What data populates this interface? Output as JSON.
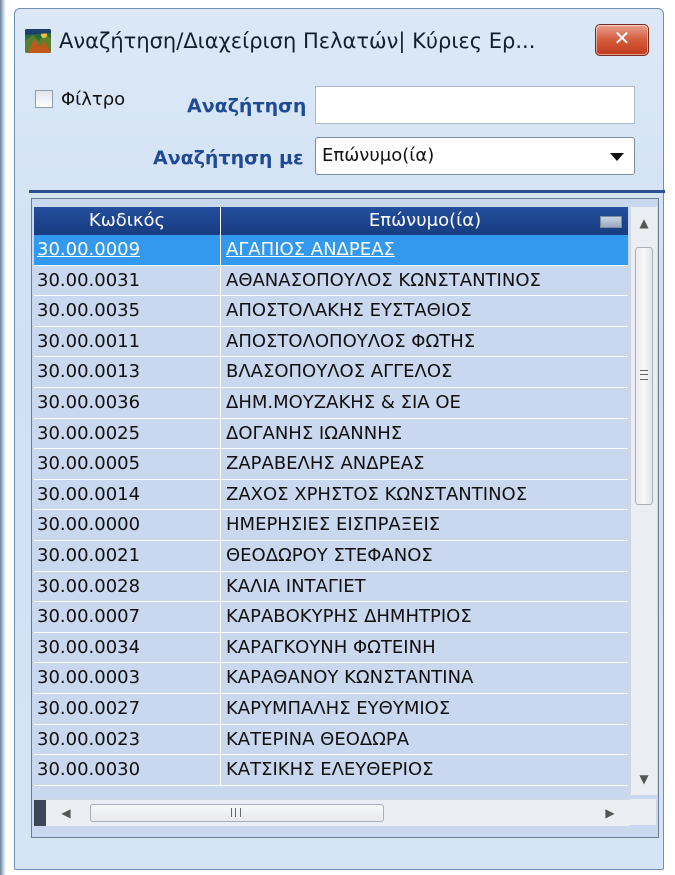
{
  "window": {
    "title": "Αναζήτηση/Διαχείριση Πελατών| Κύριες Ερ...",
    "close_label": "✕"
  },
  "filter": {
    "checkbox_label": "Φίλτρο",
    "checked": false
  },
  "search": {
    "label": "Αναζήτηση",
    "value": "",
    "placeholder": ""
  },
  "search_by": {
    "label": "Αναζήτηση με",
    "selected": "Επώνυμο(ία)"
  },
  "grid": {
    "columns": [
      "Κωδικός",
      "Επώνυμο(ία)"
    ],
    "rows": [
      {
        "code": "30.00.0009",
        "name": "ΑΓΑΠΙΟΣ ΑΝΔΡΕΑΣ",
        "selected": true
      },
      {
        "code": "30.00.0031",
        "name": "ΑΘΑΝΑΣΟΠΟΥΛΟΣ ΚΩΝΣΤΑΝΤΙΝΟΣ"
      },
      {
        "code": "30.00.0035",
        "name": "ΑΠΟΣΤΟΛΑΚΗΣ ΕΥΣΤΑΘΙΟΣ"
      },
      {
        "code": "30.00.0011",
        "name": "ΑΠΟΣΤΟΛΟΠΟΥΛΟΣ ΦΩΤΗΣ"
      },
      {
        "code": "30.00.0013",
        "name": "ΒΛΑΣΟΠΟΥΛΟΣ ΑΓΓΕΛΟΣ"
      },
      {
        "code": "30.00.0036",
        "name": "ΔΗΜ.ΜΟΥΖΑΚΗΣ & ΣΙΑ ΟΕ"
      },
      {
        "code": "30.00.0025",
        "name": "ΔΟΓΑΝΗΣ ΙΩΑΝΝΗΣ"
      },
      {
        "code": "30.00.0005",
        "name": "ΖΑΡΑΒΕΛΗΣ ΑΝΔΡΕΑΣ"
      },
      {
        "code": "30.00.0014",
        "name": "ΖΑΧΟΣ ΧΡΗΣΤΟΣ ΚΩΝΣΤΑΝΤΙΝΟΣ"
      },
      {
        "code": "30.00.0000",
        "name": "ΗΜΕΡΗΣΙΕΣ ΕΙΣΠΡΑΞΕΙΣ"
      },
      {
        "code": "30.00.0021",
        "name": "ΘΕΟΔΩΡΟΥ ΣΤΕΦΑΝΟΣ"
      },
      {
        "code": "30.00.0028",
        "name": "ΚΑΛΙΑ ΙΝΤΑΓΙΕΤ"
      },
      {
        "code": "30.00.0007",
        "name": "ΚΑΡΑΒΟΚΥΡΗΣ ΔΗΜΗΤΡΙΟΣ"
      },
      {
        "code": "30.00.0034",
        "name": "ΚΑΡΑΓΚΟΥΝΗ ΦΩΤΕΙΝΗ"
      },
      {
        "code": "30.00.0003",
        "name": "ΚΑΡΑΘΑΝΟΥ ΚΩΝΣΤΑΝΤΙΝΑ"
      },
      {
        "code": "30.00.0027",
        "name": "ΚΑΡΥΜΠΑΛΗΣ ΕΥΘΥΜΙΟΣ"
      },
      {
        "code": "30.00.0023",
        "name": "ΚΑΤΕΡΙΝΑ ΘΕΟΔΩΡΑ"
      },
      {
        "code": "30.00.0030",
        "name": "ΚΑΤΣΙΚΗΣ ΕΛΕΥΘΕΡΙΟΣ"
      }
    ]
  },
  "icons": {
    "app": "customer-app-icon",
    "close": "close-icon",
    "sort": "sort-indicator-icon",
    "scroll_up": "▲",
    "scroll_down": "▼",
    "scroll_left": "◀",
    "scroll_right": "▶"
  },
  "colors": {
    "header_bg": "#1f4a96",
    "selected_row": "#3399ee",
    "row_bg": "#c9d8ee",
    "label_blue": "#1f4a96",
    "close_red": "#d45b3d"
  }
}
